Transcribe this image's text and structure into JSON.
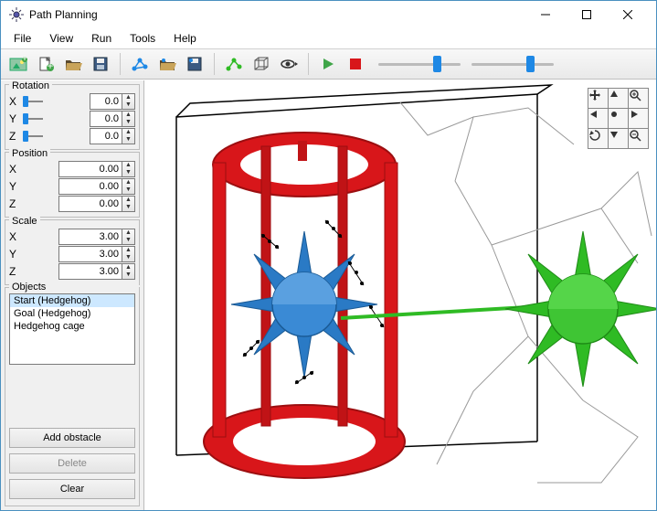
{
  "window": {
    "title": "Path Planning"
  },
  "menu": {
    "items": [
      "File",
      "View",
      "Run",
      "Tools",
      "Help"
    ]
  },
  "sidebar": {
    "rotation": {
      "legend": "Rotation",
      "x": {
        "label": "X",
        "value": "0.0"
      },
      "y": {
        "label": "Y",
        "value": "0.0"
      },
      "z": {
        "label": "Z",
        "value": "0.0"
      }
    },
    "position": {
      "legend": "Position",
      "x": {
        "label": "X",
        "value": "0.00"
      },
      "y": {
        "label": "Y",
        "value": "0.00"
      },
      "z": {
        "label": "Z",
        "value": "0.00"
      }
    },
    "scale": {
      "legend": "Scale",
      "x": {
        "label": "X",
        "value": "3.00"
      },
      "y": {
        "label": "Y",
        "value": "3.00"
      },
      "z": {
        "label": "Z",
        "value": "3.00"
      }
    },
    "objects": {
      "legend": "Objects",
      "items": [
        {
          "label": "Start (Hedgehog)",
          "selected": true
        },
        {
          "label": "Goal (Hedgehog)",
          "selected": false
        },
        {
          "label": "Hedgehog cage",
          "selected": false
        }
      ],
      "buttons": {
        "add_obstacle": "Add obstacle",
        "delete": "Delete",
        "clear": "Clear"
      }
    }
  },
  "colors": {
    "cage": "#d8161a",
    "start_object": "#2a7ac5",
    "goal_object": "#2fbb24",
    "links": "#999999"
  }
}
